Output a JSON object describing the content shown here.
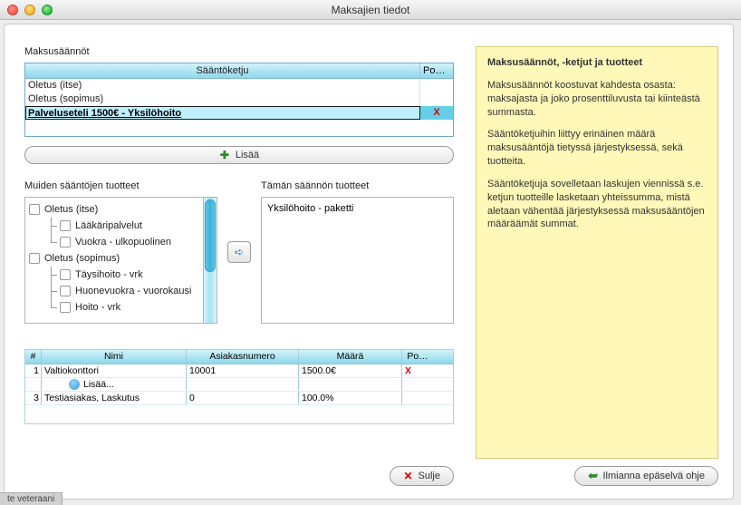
{
  "window": {
    "title": "Maksajien tiedot"
  },
  "rules": {
    "label": "Maksusäännöt",
    "col_chain": "Sääntöketju",
    "col_po": "Po…",
    "rows": [
      {
        "name": "Oletus (itse)",
        "del": ""
      },
      {
        "name": "Oletus (sopimus)",
        "del": ""
      },
      {
        "name": "Palveluseteli 1500€ - Yksilöhoito",
        "del": "X"
      }
    ],
    "add_label": "Lisää"
  },
  "trees": {
    "left_label": "Muiden sääntöjen tuotteet",
    "right_label": "Tämän säännön tuotteet",
    "right_item": "Yksilöhoito - paketti",
    "items": [
      {
        "label": "Oletus (itse)",
        "children": [
          "Lääkäripalvelut",
          "Vuokra - ulkopuolinen"
        ]
      },
      {
        "label": "Oletus (sopimus)",
        "children": [
          "Täysihoito - vrk",
          "Huonevuokra - vuorokausi",
          "Hoito - vrk"
        ]
      }
    ]
  },
  "payers": {
    "col_num": "#",
    "col_name": "Nimi",
    "col_asnum": "Asiakasnumero",
    "col_amount": "Määrä",
    "col_po": "Po…",
    "rows": [
      {
        "n": "1",
        "name": "Valtiokonttori",
        "asnum": "10001",
        "amount": "1500.0€",
        "del": "X"
      },
      {
        "n": "",
        "name": "Lisää...",
        "asnum": "",
        "amount": "",
        "del": "",
        "add": true
      },
      {
        "n": "3",
        "name": "Testiasiakas, Laskutus",
        "asnum": "0",
        "amount": "100.0%",
        "del": ""
      }
    ]
  },
  "buttons": {
    "close": "Sulje",
    "report": "Ilmianna epäselvä ohje"
  },
  "help": {
    "title": "Maksusäännöt, -ketjut ja tuotteet",
    "p1": "Maksusäännöt koostuvat kahdesta osasta: maksajasta ja joko prosenttiluvusta tai kiinteästä summasta.",
    "p2": "Sääntöketjuihin liittyy erinäinen määrä maksusääntöjä tietyssä järjestyksessä, sekä tuotteita.",
    "p3": "Sääntöketjuja sovelletaan laskujen viennissä s.e. ketjun tuotteille lasketaan yhteissumma, mistä aletaan vähentää järjestyksessä maksusääntöjen määräämät summat."
  },
  "footer": {
    "tab": "te veteraani"
  }
}
